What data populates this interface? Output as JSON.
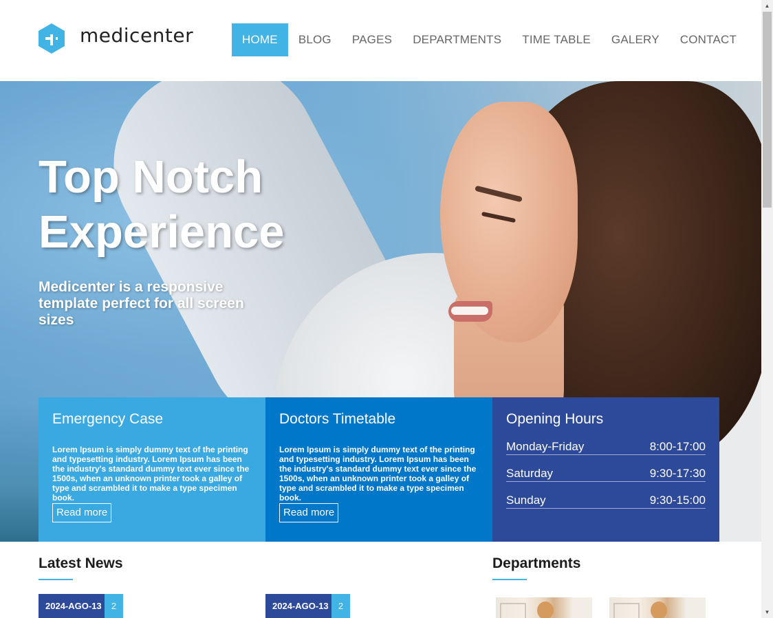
{
  "brand": {
    "name": "medicenter",
    "color": "#42b3e5"
  },
  "nav": {
    "items": [
      {
        "label": "HOME",
        "active": true
      },
      {
        "label": "BLOG",
        "active": false
      },
      {
        "label": "PAGES",
        "active": false
      },
      {
        "label": "DEPARTMENTS",
        "active": false
      },
      {
        "label": "TIME TABLE",
        "active": false
      },
      {
        "label": "GALERY",
        "active": false
      },
      {
        "label": "CONTACT",
        "active": false
      }
    ]
  },
  "hero": {
    "title_line1": "Top Notch",
    "title_line2": "Experience",
    "subtitle": "Medicenter is a responsive template perfect for all screen sizes"
  },
  "boxes": {
    "emergency": {
      "title": "Emergency Case",
      "text": "Lorem Ipsum is simply dummy text of the printing and typesetting industry. Lorem Ipsum has been the industry's standard dummy text ever since the 1500s, when an unknown printer took a galley of type and scrambled it to make a type specimen book.",
      "button": "Read more",
      "color": "#3aa9e1"
    },
    "timetable": {
      "title": "Doctors Timetable",
      "text": "Lorem Ipsum is simply dummy text of the printing and typesetting industry. Lorem Ipsum has been the industry's standard dummy text ever since the 1500s, when an unknown printer took a galley of type and scrambled it to make a type specimen book.",
      "button": "Read more",
      "color": "#0077c8"
    },
    "hours": {
      "title": "Opening Hours",
      "rows": [
        {
          "day": "Monday-Friday",
          "time": "8:00-17:00"
        },
        {
          "day": "Saturday",
          "time": "9:30-17:30"
        },
        {
          "day": "Sunday",
          "time": "9:30-15:00"
        }
      ],
      "color": "#2d4a9a"
    }
  },
  "latest_news": {
    "title": "Latest News",
    "items": [
      {
        "date": "2024-AGO-13",
        "comments": "2"
      },
      {
        "date": "2024-AGO-13",
        "comments": "2"
      }
    ]
  },
  "departments": {
    "title": "Departments"
  }
}
